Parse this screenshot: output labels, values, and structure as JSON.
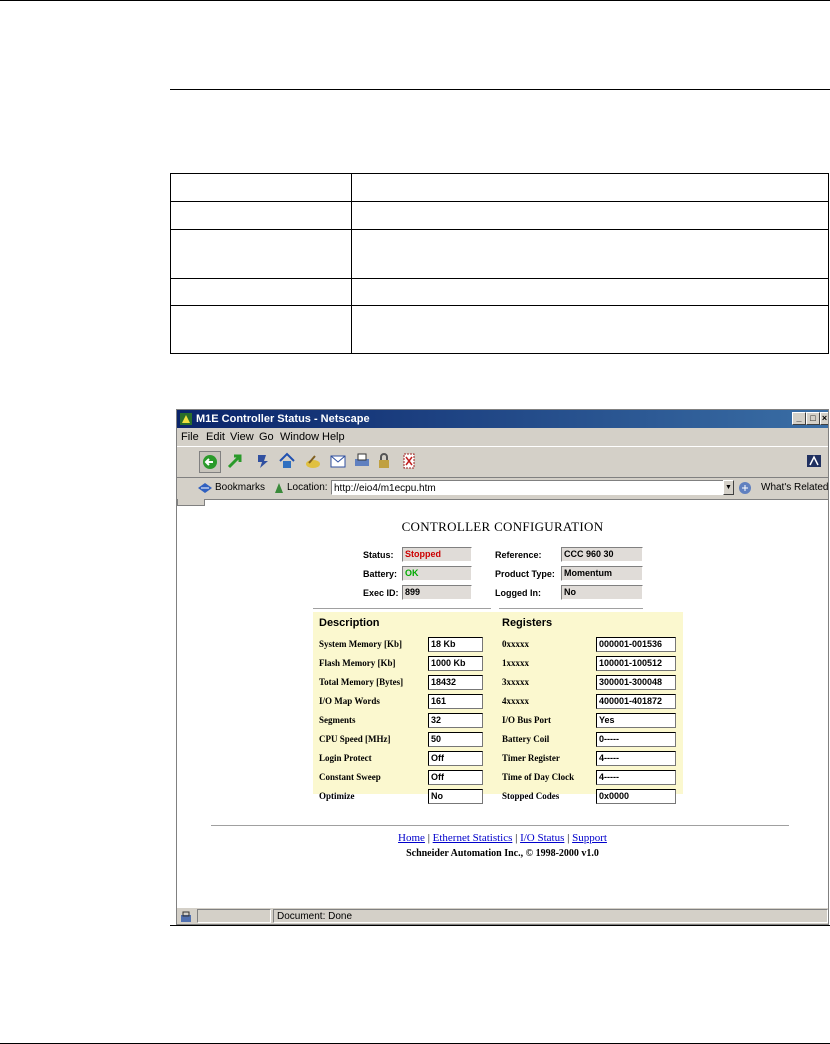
{
  "browser": {
    "title": "M1E Controller Status - Netscape",
    "menu": [
      "File",
      "Edit",
      "View",
      "Go",
      "Window",
      "Help"
    ],
    "bookmarks_label": "Bookmarks",
    "location_label": "Location:",
    "location_url": "http://eio4/m1ecpu.htm",
    "related_label": "What's Related",
    "status_text": "Document: Done",
    "accent_color": "#0a246a"
  },
  "page": {
    "title": "CONTROLLER CONFIGURATION",
    "top": {
      "status_label": "Status:",
      "status_value": "Stopped",
      "status_color": "#cc0000",
      "battery_label": "Battery:",
      "battery_value": "OK",
      "battery_color": "#00aa00",
      "exec_label": "Exec ID:",
      "exec_value": "899",
      "reference_label": "Reference:",
      "reference_value": "CCC 960 30",
      "product_label": "Product Type:",
      "product_value": "Momentum",
      "logged_label": "Logged In:",
      "logged_value": "No"
    },
    "description_header": "Description",
    "registers_header": "Registers",
    "description_rows": [
      {
        "label": "System Memory [Kb]",
        "value": "18 Kb"
      },
      {
        "label": "Flash Memory [Kb]",
        "value": "1000 Kb"
      },
      {
        "label": "Total Memory [Bytes]",
        "value": "18432"
      },
      {
        "label": "I/O Map Words",
        "value": "161"
      },
      {
        "label": "Segments",
        "value": "32"
      },
      {
        "label": "CPU Speed [MHz]",
        "value": "50"
      },
      {
        "label": "Login Protect",
        "value": "Off"
      },
      {
        "label": "Constant Sweep",
        "value": "Off"
      },
      {
        "label": "Optimize",
        "value": "No"
      }
    ],
    "register_rows": [
      {
        "label": "0xxxxx",
        "value": "000001-001536"
      },
      {
        "label": "1xxxxx",
        "value": "100001-100512"
      },
      {
        "label": "3xxxxx",
        "value": "300001-300048"
      },
      {
        "label": "4xxxxx",
        "value": "400001-401872"
      },
      {
        "label": "I/O Bus Port",
        "value": "Yes"
      },
      {
        "label": "Battery Coil",
        "value": "0-----"
      },
      {
        "label": "Timer Register",
        "value": "4-----"
      },
      {
        "label": "Time of Day Clock",
        "value": "4-----"
      },
      {
        "label": "Stopped Codes",
        "value": "0x0000"
      }
    ],
    "footer_links": [
      "Home",
      "Ethernet Statistics",
      "I/O Status",
      "Support"
    ],
    "copyright": "Schneider Automation Inc., © 1998-2000 v1.0"
  }
}
